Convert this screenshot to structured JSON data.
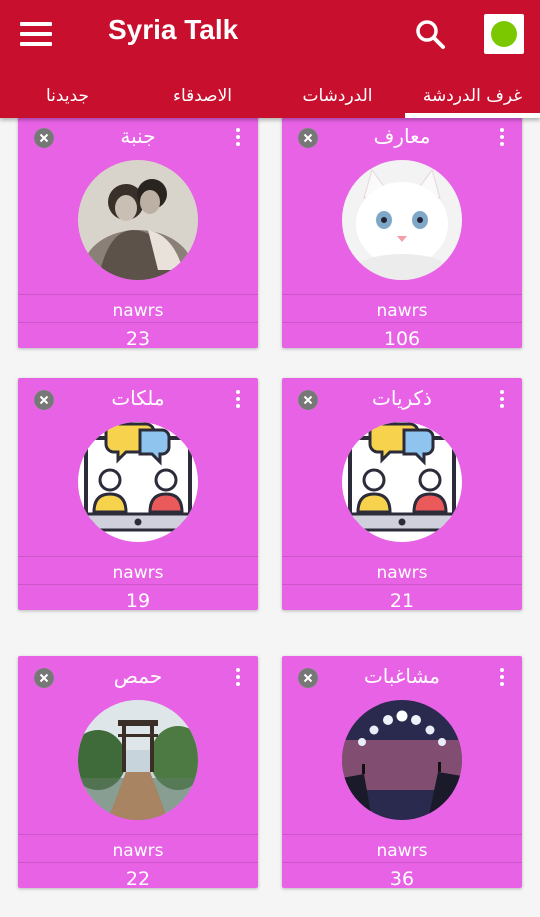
{
  "app": {
    "title": "Syria Talk",
    "status_color": "#7cc800",
    "brand_color": "#c8102e",
    "card_color": "#e862e6"
  },
  "tabs": [
    {
      "label": "غرف الدردشة",
      "active": true
    },
    {
      "label": "الدردشات",
      "active": false
    },
    {
      "label": "الاصدقاء",
      "active": false
    },
    {
      "label": "جديدنا",
      "active": false
    }
  ],
  "rooms": [
    {
      "name": "جنبة",
      "owner": "nawrs",
      "count": "23",
      "image": "couple-photo"
    },
    {
      "name": "معارف",
      "owner": "nawrs",
      "count": "106",
      "image": "white-cat-photo"
    },
    {
      "name": "ملكات",
      "owner": "nawrs",
      "count": "19",
      "image": "chat-users-icon"
    },
    {
      "name": "ذكريات",
      "owner": "nawrs",
      "count": "21",
      "image": "chat-users-icon"
    },
    {
      "name": "حمص",
      "owner": "nawrs",
      "count": "22",
      "image": "bridge-photo"
    },
    {
      "name": "مشاغبات",
      "owner": "nawrs",
      "count": "36",
      "image": "moon-phases-photo"
    }
  ]
}
